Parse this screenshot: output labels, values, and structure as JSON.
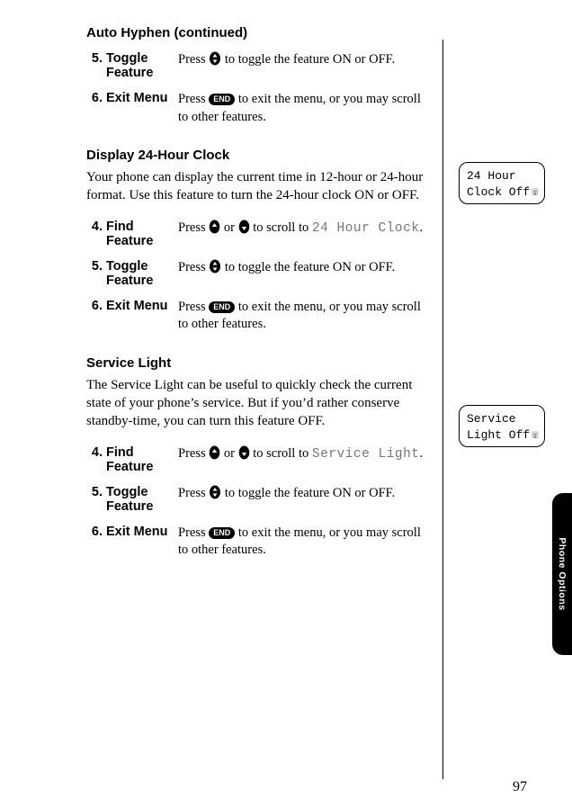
{
  "page_number": "97",
  "side_tab": "Phone Options",
  "sections": {
    "auto_hyphen": {
      "title": "Auto Hyphen (continued)",
      "steps": [
        {
          "num": "5.",
          "label": "Toggle Feature",
          "desc_pre": "Press ",
          "key": "updown",
          "desc_post": " to toggle the feature ON or OFF."
        },
        {
          "num": "6.",
          "label": "Exit Menu",
          "desc_pre": "Press ",
          "key": "END",
          "desc_post": " to exit the menu, or you may scroll to other features."
        }
      ]
    },
    "clock": {
      "title": "Display 24-Hour Clock",
      "intro": "Your phone can display the current time in 12-hour or 24-hour format. Use this feature to turn the 24-hour clock ON or OFF.",
      "screen_line1": "24 Hour",
      "screen_line2": "Clock Off",
      "steps": [
        {
          "num": "4.",
          "label": "Find Feature",
          "desc_pre": "Press ",
          "key": "up",
          "desc_mid": " or ",
          "key2": "down",
          "desc_mid2": " to scroll to ",
          "lcd": "24 Hour Clock",
          "desc_post": "."
        },
        {
          "num": "5.",
          "label": "Toggle Feature",
          "desc_pre": "Press ",
          "key": "updown",
          "desc_post": " to toggle the feature ON or OFF."
        },
        {
          "num": "6.",
          "label": "Exit Menu",
          "desc_pre": "Press ",
          "key": "END",
          "desc_post": " to exit the menu, or you may scroll to other features."
        }
      ]
    },
    "service": {
      "title": "Service Light",
      "intro": "The Service Light can be useful to quickly check the current state of your phone’s service. But if you’d rather conserve standby-time, you can turn this feature OFF.",
      "screen_line1": "Service",
      "screen_line2": "Light Off",
      "steps": [
        {
          "num": "4.",
          "label": "Find Feature",
          "desc_pre": "Press ",
          "key": "up",
          "desc_mid": " or ",
          "key2": "down",
          "desc_mid2": " to scroll to ",
          "lcd": "Service Light",
          "desc_post": "."
        },
        {
          "num": "5.",
          "label": "Toggle Feature",
          "desc_pre": "Press ",
          "key": "updown",
          "desc_post": " to toggle the feature ON or OFF."
        },
        {
          "num": "6.",
          "label": "Exit Menu",
          "desc_pre": "Press ",
          "key": "END",
          "desc_post": " to exit the menu, or you may scroll to other features."
        }
      ]
    }
  }
}
